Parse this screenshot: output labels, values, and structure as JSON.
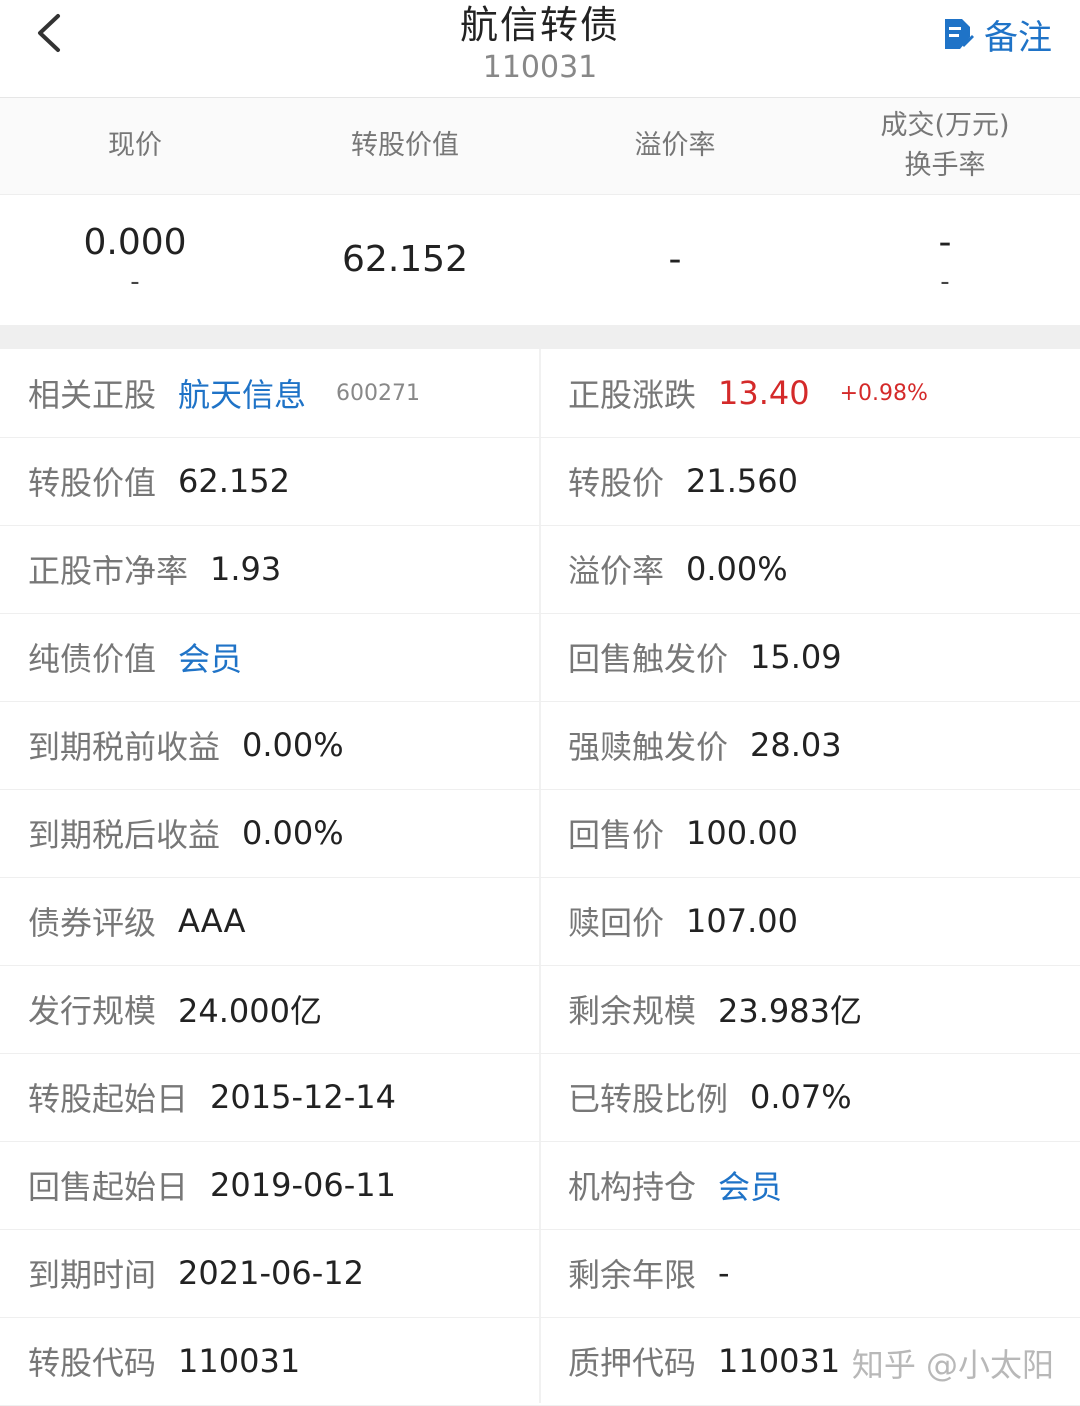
{
  "header": {
    "title": "航信转债",
    "code": "110031",
    "note_label": "备注"
  },
  "summary": {
    "headers": [
      "现价",
      "转股价值",
      "溢价率",
      "成交(万元)",
      "换手率"
    ],
    "price": "0.000",
    "price_sub": "-",
    "conv_value": "62.152",
    "premium": "-",
    "volume": "-",
    "turnover": "-"
  },
  "details": {
    "rows": [
      {
        "left": {
          "label": "相关正股",
          "value": "航天信息",
          "sub": "600271"
        },
        "right": {
          "label": "正股涨跌",
          "value": "13.40",
          "sub": "+0.98%"
        }
      },
      {
        "left": {
          "label": "转股价值",
          "value": "62.152"
        },
        "right": {
          "label": "转股价",
          "value": "21.560"
        }
      },
      {
        "left": {
          "label": "正股市净率",
          "value": "1.93"
        },
        "right": {
          "label": "溢价率",
          "value": "0.00%"
        }
      },
      {
        "left": {
          "label": "纯债价值",
          "value": "会员"
        },
        "right": {
          "label": "回售触发价",
          "value": "15.09"
        }
      },
      {
        "left": {
          "label": "到期税前收益",
          "value": "0.00%"
        },
        "right": {
          "label": "强赎触发价",
          "value": "28.03"
        }
      },
      {
        "left": {
          "label": "到期税后收益",
          "value": "0.00%"
        },
        "right": {
          "label": "回售价",
          "value": "100.00"
        }
      },
      {
        "left": {
          "label": "债券评级",
          "value": "AAA"
        },
        "right": {
          "label": "赎回价",
          "value": "107.00"
        }
      },
      {
        "left": {
          "label": "发行规模",
          "value": "24.000亿"
        },
        "right": {
          "label": "剩余规模",
          "value": "23.983亿"
        }
      },
      {
        "left": {
          "label": "转股起始日",
          "value": "2015-12-14"
        },
        "right": {
          "label": "已转股比例",
          "value": "0.07%"
        }
      },
      {
        "left": {
          "label": "回售起始日",
          "value": "2019-06-11"
        },
        "right": {
          "label": "机构持仓",
          "value": "会员"
        }
      },
      {
        "left": {
          "label": "到期时间",
          "value": "2021-06-12"
        },
        "right": {
          "label": "剩余年限",
          "value": "-"
        }
      },
      {
        "left": {
          "label": "转股代码",
          "value": "110031"
        },
        "right": {
          "label": "质押代码",
          "value": "110031"
        }
      }
    ]
  },
  "watermark": "知乎 @小太阳",
  "colors": {
    "accent": "#1f73c7",
    "up": "#d42a2a",
    "label": "#777777"
  },
  "icons": [
    "back-arrow-icon",
    "note-edit-icon"
  ]
}
